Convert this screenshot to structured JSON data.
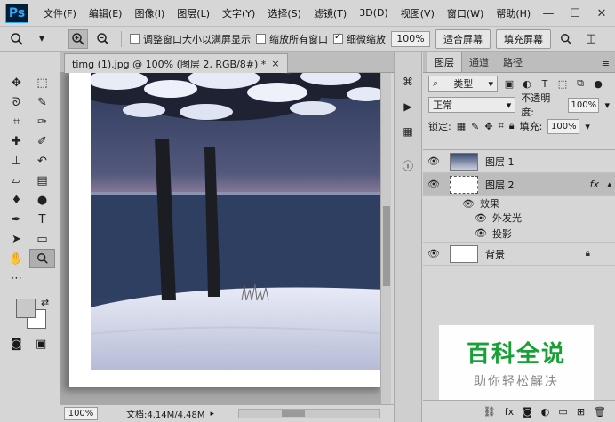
{
  "app": {
    "logo": "Ps",
    "menu": [
      "文件(F)",
      "编辑(E)",
      "图像(I)",
      "图层(L)",
      "文字(Y)",
      "选择(S)",
      "滤镜(T)",
      "3D(D)",
      "视图(V)",
      "窗口(W)",
      "帮助(H)"
    ],
    "window_controls": [
      "—",
      "☐",
      "✕"
    ]
  },
  "options_bar": {
    "check_resize_window": "调整窗口大小以满屏显示",
    "check_zoom_all": "缩放所有窗口",
    "check_scrubby_zoom": "细微缩放",
    "zoom_value": "100%",
    "fit_screen_label": "适合屏幕",
    "fill_screen_label": "填充屏幕"
  },
  "document": {
    "tab_title": "timg (1).jpg @ 100% (图层 2, RGB/8#) *",
    "tab_close": "×"
  },
  "status_bar": {
    "zoom": "100%",
    "doc_size": "文档:4.14M/4.48M"
  },
  "layers_panel": {
    "tabs": [
      "图层",
      "通道",
      "路径"
    ],
    "filter_label": "类型",
    "blend_mode": "正常",
    "opacity_label": "不透明度:",
    "opacity_value": "100%",
    "lock_label": "锁定:",
    "fill_label": "填充:",
    "fill_value": "100%",
    "layers": [
      {
        "name": "图层 1"
      },
      {
        "name": "图层 2",
        "fx": "fx"
      },
      {
        "name": "背景"
      }
    ],
    "effects_label": "效果",
    "effects": [
      "外发光",
      "投影"
    ]
  },
  "watermark": {
    "title": "百科全说",
    "subtitle": "助你轻松解决"
  },
  "colors": {
    "ui_bg": "#d6d6d6",
    "canvas_bg": "#a8a8a8",
    "watermark_green": "#18a036"
  }
}
